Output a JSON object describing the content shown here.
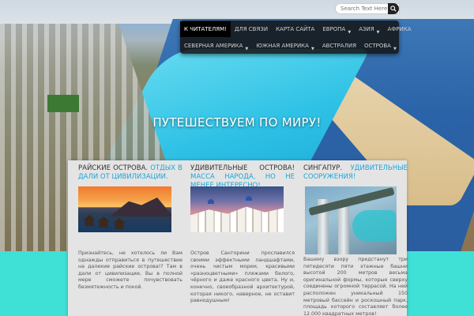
{
  "search": {
    "placeholder": "Search Text Here"
  },
  "nav": {
    "row1": [
      {
        "label": "К ЧИТАТЕЛЯМ!",
        "active": true,
        "dropdown": false
      },
      {
        "label": "ДЛЯ СВЯЗИ",
        "active": false,
        "dropdown": false
      },
      {
        "label": "КАРТА САЙТА",
        "active": false,
        "dropdown": false
      },
      {
        "label": "ЕВРОПА",
        "active": false,
        "dropdown": true
      },
      {
        "label": "АЗИЯ",
        "active": false,
        "dropdown": true
      },
      {
        "label": "АФРИКА",
        "active": false,
        "dropdown": false
      }
    ],
    "row2": [
      {
        "label": "СЕВЕРНАЯ АМЕРИКА",
        "active": false,
        "dropdown": true
      },
      {
        "label": "ЮЖНАЯ АМЕРИКА",
        "active": false,
        "dropdown": true
      },
      {
        "label": "АВСТРАЛИЯ",
        "active": false,
        "dropdown": false
      },
      {
        "label": "ОСТРОВА",
        "active": false,
        "dropdown": true
      }
    ]
  },
  "hero": {
    "title": "ПУТЕШЕСТВУЕМ ПО МИРУ!"
  },
  "articles": [
    {
      "title": "РАЙСКИЕ ОСТРОВА.",
      "highlight": "ОТДЫХ В ДАЛИ ОТ ЦИВИЛИЗАЦИИ.",
      "text": "Признайтесь, не хотелось ли Вам однажды отправиться в путешествие на далекие райские острова!? Там в дали от цивилизации, Вы в полной мере сможете почувствовать безмятежность и покой."
    },
    {
      "title": "УДИВИТЕЛЬНЫЕ ОСТРОВА!",
      "highlight": "МАССА НАРОДА, НО НЕ МЕНЕЕ ИНТЕРЕСНО!",
      "text": "Остров Санторини прославился своими эффектными ландшафтами, очень чистым морем, красивыми «разноцветными» пляжами белого, чёрного и даже красного цвета. Ну и, конечно, своеобразной архитектурой, которая никого, наверное, не оставит равнодушным!"
    },
    {
      "title": "СИНГАПУР.",
      "highlight": "УДИВИТЕЛЬНЫЕ СООРУЖЕНИЯ!",
      "text": "Вашему взору предстанут три пятидесяти пяти этажные башни высотой 200 метров весьма оригинальной формы, которые сверху соединены огромной террасой. На ней расположен уникальный 150 метровый бассейн и роскошный парк, площадь которого составляет более 12.000 квадратных метров!"
    }
  ],
  "colors": {
    "accent": "#1fa5d6",
    "nav_bg": "#1a1a1a",
    "page_bg": "#3fe0d6"
  }
}
